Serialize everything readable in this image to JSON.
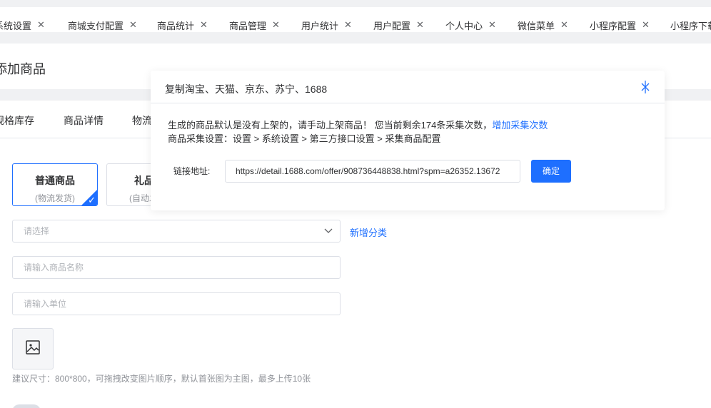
{
  "tabs": [
    {
      "label": "系统设置"
    },
    {
      "label": "商城支付配置"
    },
    {
      "label": "商品统计"
    },
    {
      "label": "商品管理"
    },
    {
      "label": "用户统计"
    },
    {
      "label": "用户配置"
    },
    {
      "label": "个人中心"
    },
    {
      "label": "微信菜单"
    },
    {
      "label": "小程序配置"
    },
    {
      "label": "小程序下载"
    }
  ],
  "page": {
    "title": "添加商品",
    "subtabs": [
      "规格库存",
      "商品详情",
      "物流设置"
    ]
  },
  "product_types": [
    {
      "title": "普通商品",
      "sub": "(物流发货)",
      "selected": true
    },
    {
      "title": "礼品卡",
      "sub": "(自动发货)",
      "selected": false
    }
  ],
  "form": {
    "category_placeholder": "请选择",
    "add_category": "新增分类",
    "name_placeholder": "请输入商品名称",
    "unit_placeholder": "请输入单位",
    "upload_hint": "建议尺寸：800*800，可拖拽改变图片顺序，默认首张图为主图，最多上传10张"
  },
  "modal": {
    "title": "复制淘宝、天猫、京东、苏宁、1688",
    "notice_line1": "生成的商品默认是没有上架的，请手动上架商品！ 您当前剩余174条采集次数，",
    "notice_link": "增加采集次数",
    "notice_line2": "商品采集设置：设置 > 系统设置 > 第三方接口设置 > 采集商品配置",
    "url_label": "链接地址:",
    "url_value": "https://detail.1688.com/offer/908736448838.html?spm=a26352.13672",
    "confirm": "确定"
  },
  "colors": {
    "accent": "#1e6fff",
    "bg": "#f0f1f3"
  }
}
